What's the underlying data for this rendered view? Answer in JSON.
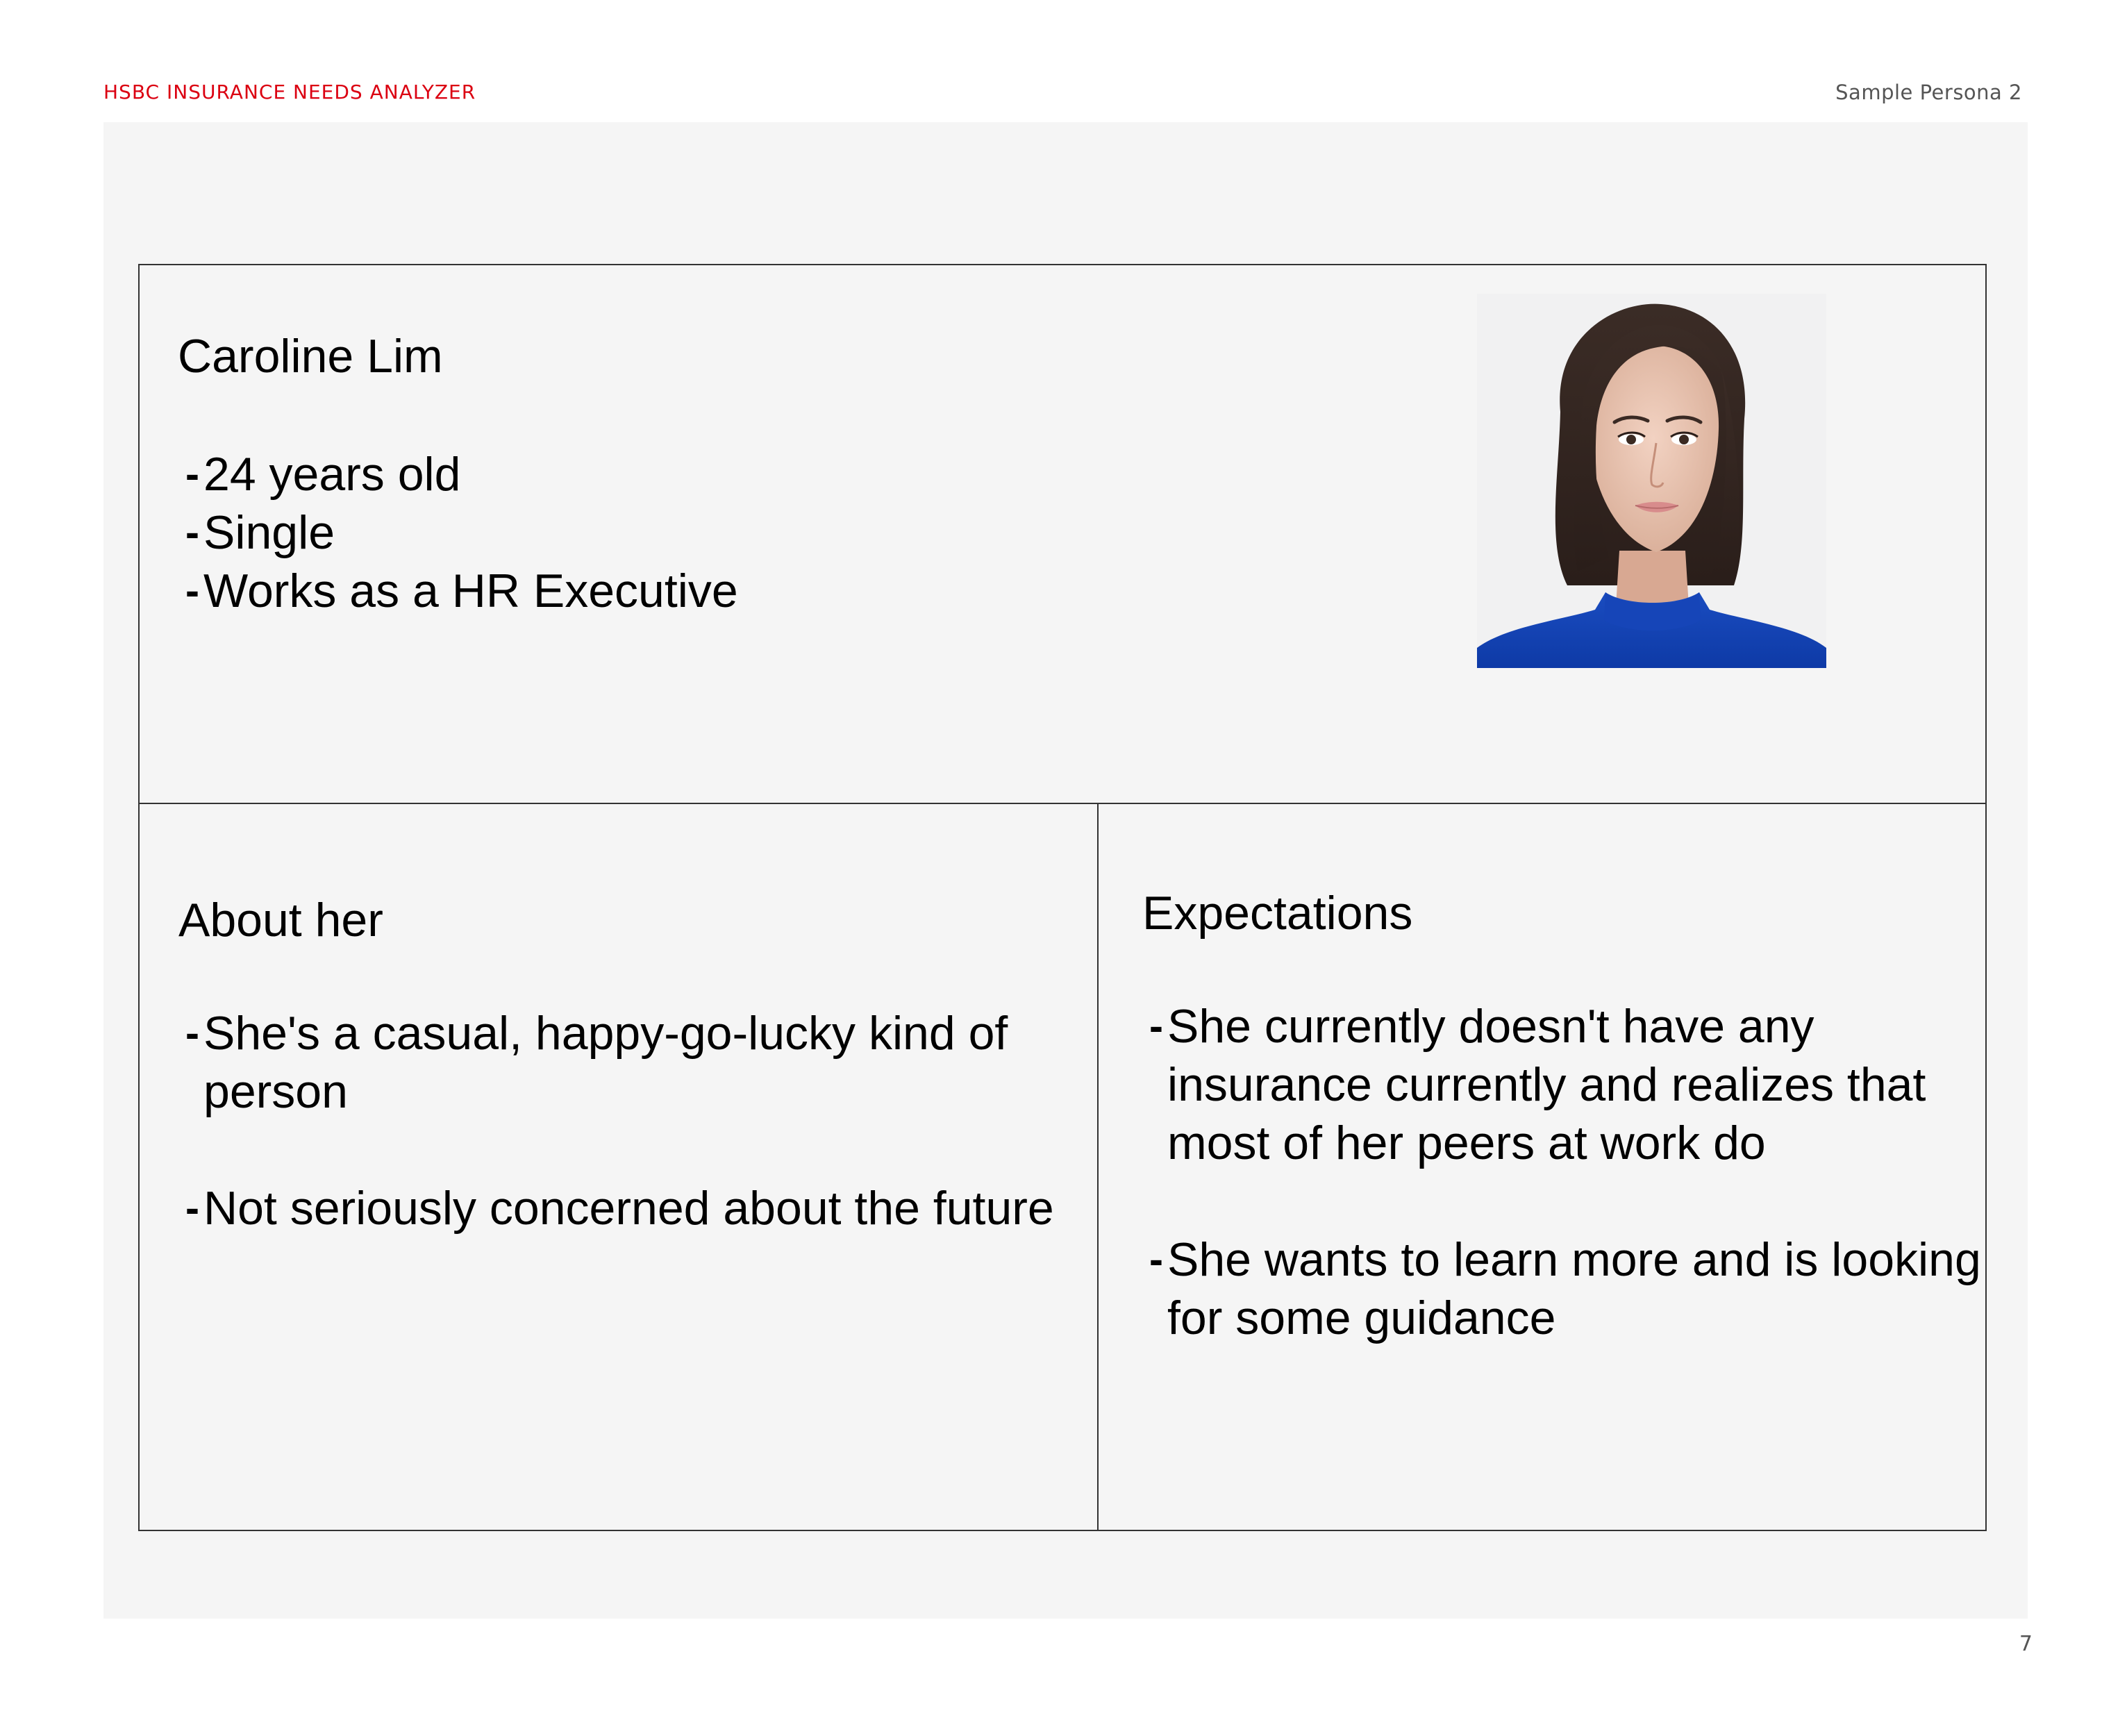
{
  "header": {
    "left_title": "HSBC INSURANCE NEEDS ANALYZER",
    "right_title": "Sample Persona 2"
  },
  "colors": {
    "brand_red": "#db0011",
    "panel_bg": "#f5f5f5",
    "border": "#333333"
  },
  "persona": {
    "name": "Caroline Lim",
    "facts": [
      "24 years old",
      "Single",
      "Works as a HR Executive"
    ],
    "photo": "portrait-photo"
  },
  "about": {
    "title": "About her",
    "items": [
      "She's a casual, happy-go-lucky kind of person",
      "Not seriously concerned about the future"
    ]
  },
  "expectations": {
    "title": "Expectations",
    "items": [
      "She currently doesn't have any insurance currently and realizes that most of her peers at work do",
      "She wants to learn more and is looking for some guidance"
    ]
  },
  "footer": {
    "page_number": "7"
  }
}
